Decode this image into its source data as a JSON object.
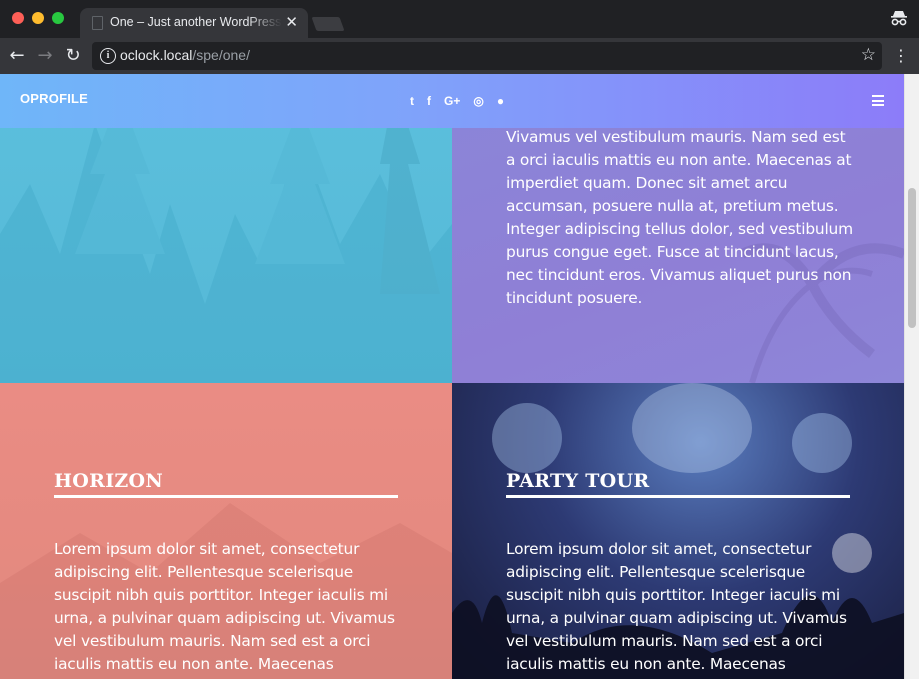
{
  "browser": {
    "tab_title": "One – Just another WordPress site",
    "url_host": "oclock.local",
    "url_path": "/spe/one/"
  },
  "site": {
    "brand": "OPROFILE",
    "social": [
      {
        "icon": "twitter-icon",
        "glyph": "t"
      },
      {
        "icon": "facebook-icon",
        "glyph": "f"
      },
      {
        "icon": "google-plus-icon",
        "glyph": "G+"
      },
      {
        "icon": "instagram-icon",
        "glyph": "◎"
      },
      {
        "icon": "github-icon",
        "glyph": "●"
      }
    ]
  },
  "panels": {
    "top_right_text": "Vivamus vel vestibulum mauris. Nam sed est a orci iaculis mattis eu non ante. Maecenas at imperdiet quam. Donec sit amet arcu accumsan, posuere nulla at, pretium metus. Integer adipiscing tellus dolor, sed vestibulum purus congue eget. Fusce at tincidunt lacus, nec tincidunt eros. Vivamus aliquet purus non tincidunt posuere.",
    "horizon": {
      "heading": "HORIZON",
      "text": "Lorem ipsum dolor sit amet, consectetur adipiscing elit. Pellentesque scelerisque suscipit nibh quis porttitor. Integer iaculis mi urna, a pulvinar quam adipiscing ut. Vivamus vel vestibulum mauris. Nam sed est a orci iaculis mattis eu non ante. Maecenas"
    },
    "party_tour": {
      "heading": "PARTY TOUR",
      "text": "Lorem ipsum dolor sit amet, consectetur adipiscing elit. Pellentesque scelerisque suscipit nibh quis porttitor. Integer iaculis mi urna, a pulvinar quam adipiscing ut. Vivamus vel vestibulum mauris. Nam sed est a orci iaculis mattis eu non ante. Maecenas"
    }
  },
  "colors": {
    "header_gradient_start": "#6fb6f9",
    "header_gradient_end": "#8c7cf9",
    "panel_blue": "#5cc0dd",
    "panel_purple": "#8a86d8",
    "panel_coral": "#ea8c84",
    "panel_night": "#2d3a74"
  }
}
